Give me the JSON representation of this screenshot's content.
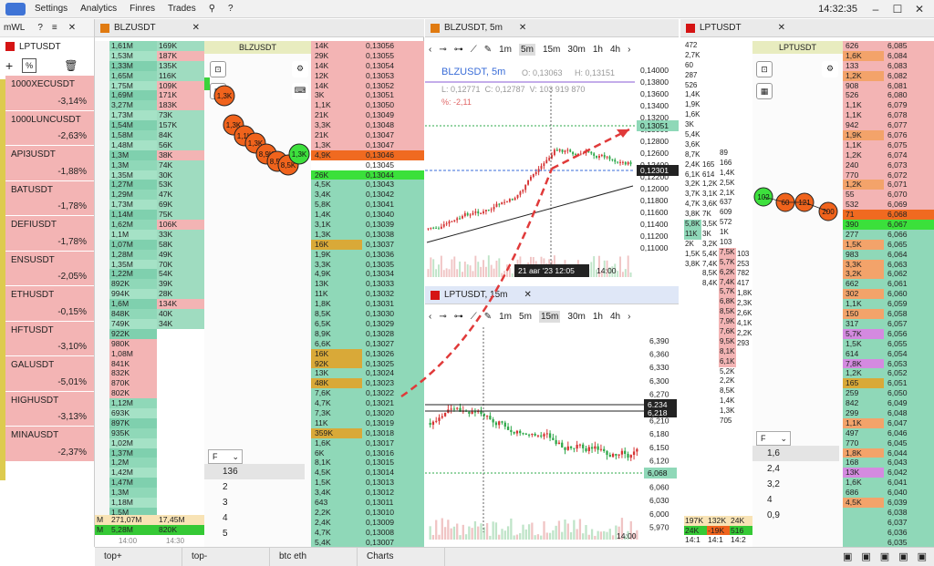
{
  "menu": {
    "settings": "Settings",
    "analytics": "Analytics",
    "finres": "Finres",
    "trades": "Trades",
    "clock": "14:32:35"
  },
  "watchlist": {
    "title": "mWL",
    "symbol": "LPTUSDT",
    "items": [
      {
        "name": "1000XECUSDT",
        "change": "-3,14%"
      },
      {
        "name": "1000LUNCUSDT",
        "change": "-2,63%"
      },
      {
        "name": "API3USDT",
        "change": "-1,88%"
      },
      {
        "name": "BATUSDT",
        "change": "-1,78%"
      },
      {
        "name": "DEFIUSDT",
        "change": "-1,78%"
      },
      {
        "name": "ENSUSDT",
        "change": "-2,05%"
      },
      {
        "name": "ETHUSDT",
        "change": "-0,15%"
      },
      {
        "name": "HFTUSDT",
        "change": "-3,10%"
      },
      {
        "name": "GALUSDT",
        "change": "-5,01%"
      },
      {
        "name": "HIGHUSDT",
        "change": "-3,13%"
      },
      {
        "name": "MINAUSDT",
        "change": "-2,37%"
      }
    ]
  },
  "blz": {
    "tab": "BLZUSDT",
    "cluster_title": "BLZUSDT",
    "left_vol": [
      "1,61M",
      "1,53M",
      "1,33M",
      "1,65M",
      "1,75M",
      "1,69M",
      "3,27M",
      "1,73M",
      "1,54M",
      "1,58M",
      "1,48M",
      "1,3M",
      "1,3M",
      "1,35M",
      "1,27M",
      "1,29M",
      "1,73M",
      "1,14M",
      "1,62M",
      "1,1M",
      "1,07M",
      "1,28M",
      "1,35M",
      "1,22M",
      "892K",
      "994K",
      "1,6M",
      "848K",
      "749K",
      "922K",
      "980K",
      "1,08M",
      "841K",
      "832K",
      "870K",
      "802K",
      "1,12M",
      "693K",
      "897K",
      "935K",
      "1,02M",
      "1,37M",
      "1,2M",
      "1,42M",
      "1,47M",
      "1,3M",
      "1,18M",
      "1,5M",
      "1,37M"
    ],
    "left_vol2": [
      "169K",
      "187K",
      "135K",
      "116K",
      "109K",
      "171K",
      "183K",
      "73K",
      "157K",
      "84K",
      "56K",
      "38K",
      "74K",
      "30K",
      "53K",
      "47K",
      "69K",
      "75K",
      "106K",
      "33K",
      "58K",
      "49K",
      "70K",
      "54K",
      "39K",
      "28K",
      "134K",
      "40K",
      "34K",
      "",
      "",
      "",
      "",
      "",
      "",
      "",
      "",
      "",
      "",
      "",
      "",
      "",
      "",
      "",
      "",
      "",
      "",
      "",
      ""
    ],
    "left_footer": [
      {
        "label": "M",
        "a": "271,07M",
        "b": "17,45M"
      },
      {
        "label": "M",
        "a": "5,28M",
        "b": "820K"
      }
    ],
    "footer_time": [
      "14:00",
      "14:30"
    ],
    "dom_vol": [
      "14K",
      "29K",
      "14K",
      "12K",
      "14K",
      "3K",
      "1,1K",
      "21K",
      "3,3K",
      "21K",
      "1,3K",
      "4,9K",
      "",
      "26K",
      "4,5K",
      "3,4K",
      "5,8K",
      "1,4K",
      "3,1K",
      "1,3K",
      "16K",
      "1,9K",
      "3,3K",
      "4,9K",
      "13K",
      "11K",
      "1,8K",
      "8,5K",
      "6,5K",
      "8,9K",
      "6,6K",
      "16K",
      "92K",
      "13K",
      "48K",
      "7,6K",
      "4,7K",
      "7,3K",
      "11K",
      "359K",
      "1,6K",
      "6K",
      "8,1K",
      "4,5K",
      "1,5K",
      "3,4K",
      "643",
      "2,2K",
      "2,4K",
      "4,7K",
      "5,4K",
      "318",
      "4,9K",
      "5,1K"
    ],
    "dom_price": [
      "0,13056",
      "0,13055",
      "0,13054",
      "0,13053",
      "0,13052",
      "0,13051",
      "0,13050",
      "0,13049",
      "0,13048",
      "0,13047",
      "0,13047",
      "0,13046",
      "0,13045",
      "0,13044",
      "0,13043",
      "0,13042",
      "0,13041",
      "0,13040",
      "0,13039",
      "0,13038",
      "0,13037",
      "0,13036",
      "0,13035",
      "0,13034",
      "0,13033",
      "0,13032",
      "0,13031",
      "0,13030",
      "0,13029",
      "0,13028",
      "0,13027",
      "0,13026",
      "0,13025",
      "0,13024",
      "0,13023",
      "0,13022",
      "0,13021",
      "0,13020",
      "0,13019",
      "0,13018",
      "0,13017",
      "0,13016",
      "0,13015",
      "0,13014",
      "0,13013",
      "0,13012",
      "0,13011",
      "0,13010",
      "0,13009",
      "0,13008",
      "0,13007",
      "0,13006",
      "0,13005",
      "0,13004"
    ],
    "bubbles": [
      "1,3K",
      "1,3K",
      "1,1K",
      "1,3K",
      "8,9K",
      "8,5K",
      "8,5K",
      "1,3K"
    ],
    "filter_label": "F",
    "filter_values": [
      "136",
      "2",
      "3",
      "4",
      "5"
    ]
  },
  "chart1": {
    "tab": "BLZUSDT, 5m",
    "title": "BLZUSDT, 5m",
    "ohlc": {
      "o": "O: 0,13063",
      "h": "H: 0,13151",
      "l": "L: 0,12771",
      "c": "C: 0,12787",
      "v": "V: 103 919 870"
    },
    "pct": "%: -2,11",
    "timeframes": [
      "1m",
      "5m",
      "15m",
      "30m",
      "1h",
      "4h"
    ],
    "yticks": [
      "0,14000",
      "0,13800",
      "0,13600",
      "0,13400",
      "0,13200",
      "0,13000",
      "0,12800",
      "0,12600",
      "0,12400",
      "0,12200",
      "0,12000",
      "0,11800",
      "0,11600",
      "0,11400",
      "0,11200",
      "0,11000"
    ],
    "current_price": "0,13051",
    "level_price": "0,12301",
    "date_label": "21 авг '23  12:05",
    "time_label": "14:00"
  },
  "chart2": {
    "tab": "LPTUSDT, 15m",
    "timeframes": [
      "1m",
      "5m",
      "15m",
      "30m",
      "1h",
      "4h"
    ],
    "yticks": [
      "6,390",
      "6,360",
      "6,330",
      "6,300",
      "6,270",
      "6,240",
      "6,210",
      "6,180",
      "6,150",
      "6,120",
      "6,090",
      "6,060",
      "6,030",
      "6,000",
      "5,970"
    ],
    "level1": "6,234",
    "level2": "6,218",
    "current_price": "6,068",
    "time_label": "14:00"
  },
  "lpt": {
    "tab": "LPTUSDT",
    "cluster_title": "LPTUSDT",
    "col1": [
      "472",
      "2,7K",
      "60",
      "287",
      "526",
      "1,4K",
      "1,9K",
      "1,6K",
      "3K",
      "5,4K",
      "3,6K",
      "8,7K",
      "2,4K",
      "6,1K",
      "3,2K",
      "3,7K",
      "4,7K",
      "3,8K",
      "5,8K",
      "11K",
      "2K",
      "1,5K",
      "3,8K"
    ],
    "col2": [
      "",
      "",
      "",
      "",
      "",
      "",
      "",
      "",
      "",
      "",
      "",
      "",
      "165",
      "614",
      "1,2K",
      "3,1K",
      "3,6K",
      "7K",
      "3,5K",
      "3K",
      "3,2K",
      "5,4K",
      "7,4K",
      "8,5K",
      "8,4K"
    ],
    "col3": [
      "89",
      "166",
      "1,4K",
      "2,5K",
      "2,1K",
      "637",
      "609",
      "572",
      "1K",
      "103",
      "7,5K",
      "5,7K",
      "6,2K",
      "7,4K",
      "5,7K",
      "6,8K",
      "8,5K",
      "7,9K",
      "7,6K",
      "9,5K",
      "8,1K",
      "6,1K",
      "5,2K",
      "2,2K",
      "8,5K",
      "1,4K",
      "1,3K",
      "705"
    ],
    "col4": [
      "",
      "",
      "",
      "",
      "",
      "",
      "",
      "",
      "",
      "",
      "",
      "",
      "",
      "",
      "",
      "",
      "",
      "",
      "",
      "",
      "",
      "103",
      "253",
      "782",
      "417",
      "1,8K",
      "2,3K",
      "2,6K",
      "4,1K",
      "2,2K",
      "293"
    ],
    "vol": [
      "626",
      "1,6K",
      "133",
      "1,2K",
      "908",
      "526",
      "1,1K",
      "1,1K",
      "942",
      "1,9K",
      "1,1K",
      "1,2K",
      "240",
      "770",
      "1,2K",
      "55",
      "532",
      "71",
      "390",
      "277",
      "1,5K",
      "983",
      "3,3K",
      "3,2K",
      "662",
      "302",
      "1,1K",
      "150",
      "317",
      "5,7K",
      "1,5K",
      "614",
      "7,8K",
      "1,2K",
      "165",
      "259",
      "842",
      "299",
      "1,1K",
      "497",
      "770",
      "1,8K",
      "168",
      "13K",
      "1,6K",
      "686",
      "4,5K"
    ],
    "price": [
      "6,085",
      "6,084",
      "6,083",
      "6,082",
      "6,081",
      "6,080",
      "6,079",
      "6,078",
      "6,077",
      "6,076",
      "6,075",
      "6,074",
      "6,073",
      "6,072",
      "6,071",
      "6,070",
      "6,069",
      "6,068",
      "6,067",
      "6,066",
      "6,065",
      "6,064",
      "6,063",
      "6,062",
      "6,061",
      "6,060",
      "6,059",
      "6,058",
      "6,057",
      "6,056",
      "6,055",
      "6,054",
      "6,053",
      "6,052",
      "6,051",
      "6,050",
      "6,049",
      "6,048",
      "6,047",
      "6,046",
      "6,045",
      "6,044",
      "6,043",
      "6,042",
      "6,041",
      "6,040",
      "6,039",
      "6,038",
      "6,037",
      "6,036",
      "6,035",
      "6,034"
    ],
    "bubbles": [
      "102",
      "60",
      "121",
      "200"
    ],
    "filter_label": "F",
    "filter_values": [
      "1,6",
      "2,4",
      "3,2",
      "4",
      "0,9"
    ],
    "footer": [
      "197K",
      "132K",
      "24K"
    ],
    "footer2": [
      "24K",
      "-19K",
      "516"
    ],
    "footer_time": [
      "14:1",
      "14:1",
      "14:2"
    ]
  },
  "bottom_tabs": [
    "top+",
    "top-",
    "btc eth",
    "Charts"
  ]
}
